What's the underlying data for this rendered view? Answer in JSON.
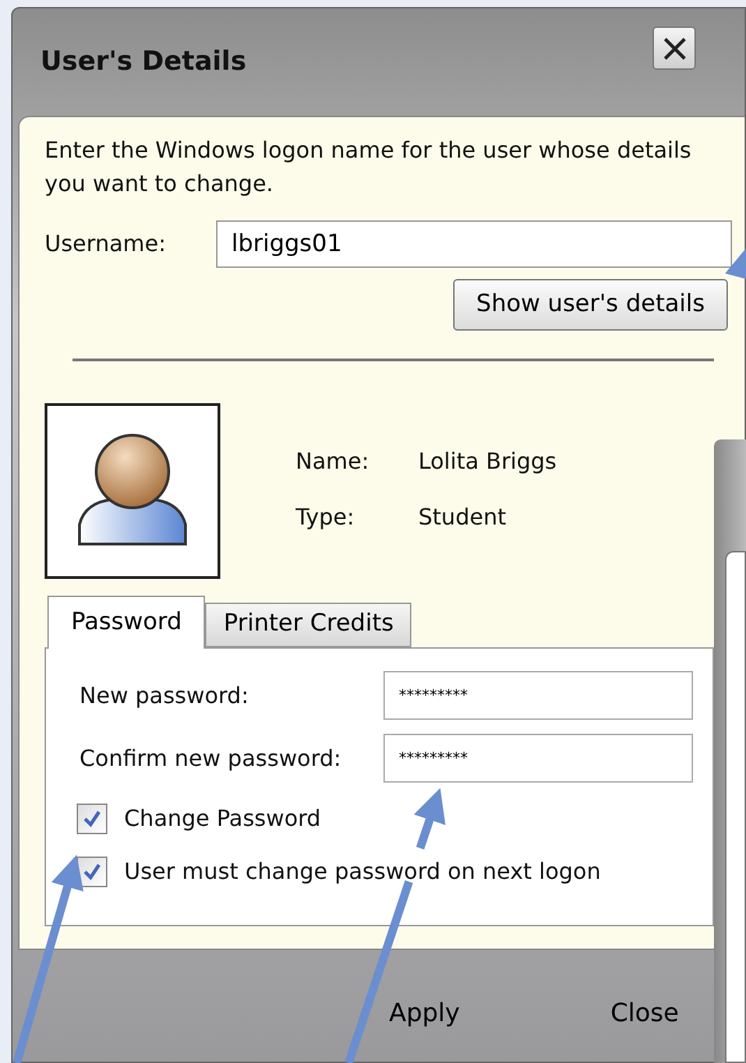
{
  "window": {
    "title": "User's Details"
  },
  "instructions": "Enter the Windows logon name for the user whose details you want to change.",
  "username": {
    "label": "Username:",
    "value": "lbriggs01"
  },
  "show_button": "Show user's details",
  "user": {
    "name_label": "Name:",
    "name": "Lolita Briggs",
    "type_label": "Type:",
    "type": "Student"
  },
  "tabs": [
    {
      "label": "Password",
      "selected": true
    },
    {
      "label": "Printer Credits",
      "selected": false
    }
  ],
  "password_fields": [
    {
      "label": "New password:",
      "value": "*********"
    },
    {
      "label": "Confirm new password:",
      "value": "*********"
    }
  ],
  "checkboxes": [
    {
      "label": "Change Password",
      "checked": true
    },
    {
      "label": "User must change password on next logon",
      "checked": true
    }
  ],
  "buttons": [
    "Apply",
    "Close"
  ]
}
